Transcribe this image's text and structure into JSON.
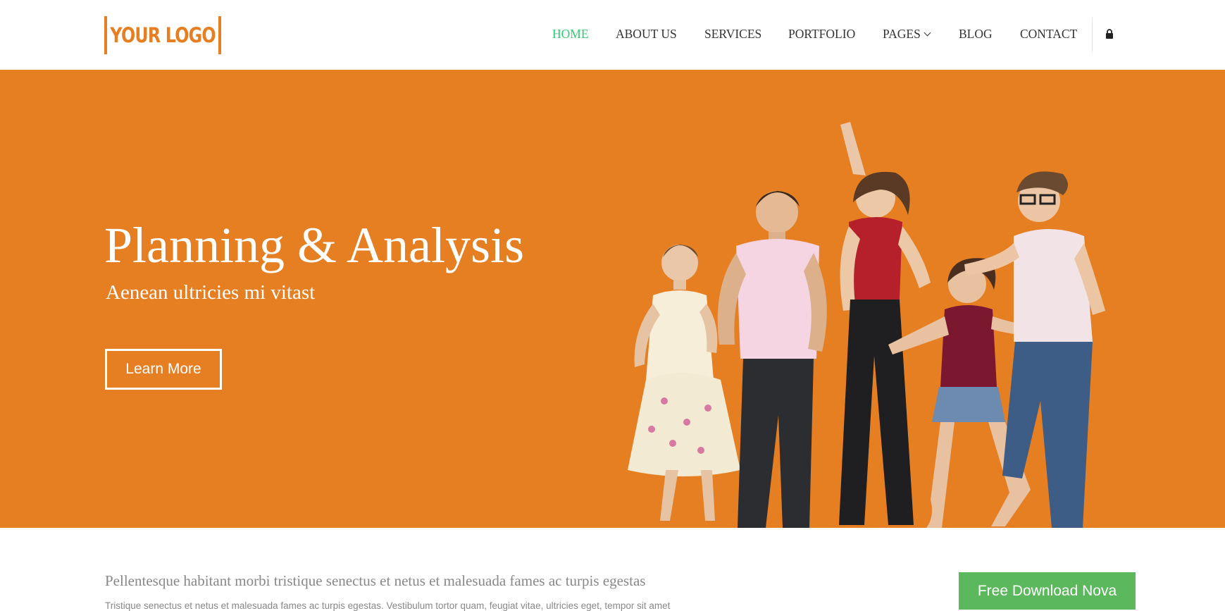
{
  "header": {
    "logo_text": "YOUR LOGO",
    "nav": [
      {
        "label": "HOME",
        "active": true
      },
      {
        "label": "ABOUT US"
      },
      {
        "label": "SERVICES"
      },
      {
        "label": "PORTFOLIO"
      },
      {
        "label": "PAGES",
        "has_dropdown": true
      },
      {
        "label": "BLOG"
      },
      {
        "label": "CONTACT"
      }
    ],
    "lock_icon": "lock-icon"
  },
  "hero": {
    "title": "Planning & Analysis",
    "subtitle": "Aenean ultricies mi vitast",
    "button_label": "Learn More",
    "background_color": "#e67e22"
  },
  "intro": {
    "heading": "Pellentesque habitant morbi tristique senectus et netus et malesuada fames ac turpis egestas",
    "text": "Tristique senectus et netus et malesuada fames ac turpis egestas. Vestibulum tortor quam, feugiat vitae, ultricies eget, tempor sit amet",
    "cta_label": "Free Download Nova",
    "cta_color": "#5cb85c"
  },
  "colors": {
    "accent": "#e67e22",
    "active_nav": "#2ecc71"
  }
}
